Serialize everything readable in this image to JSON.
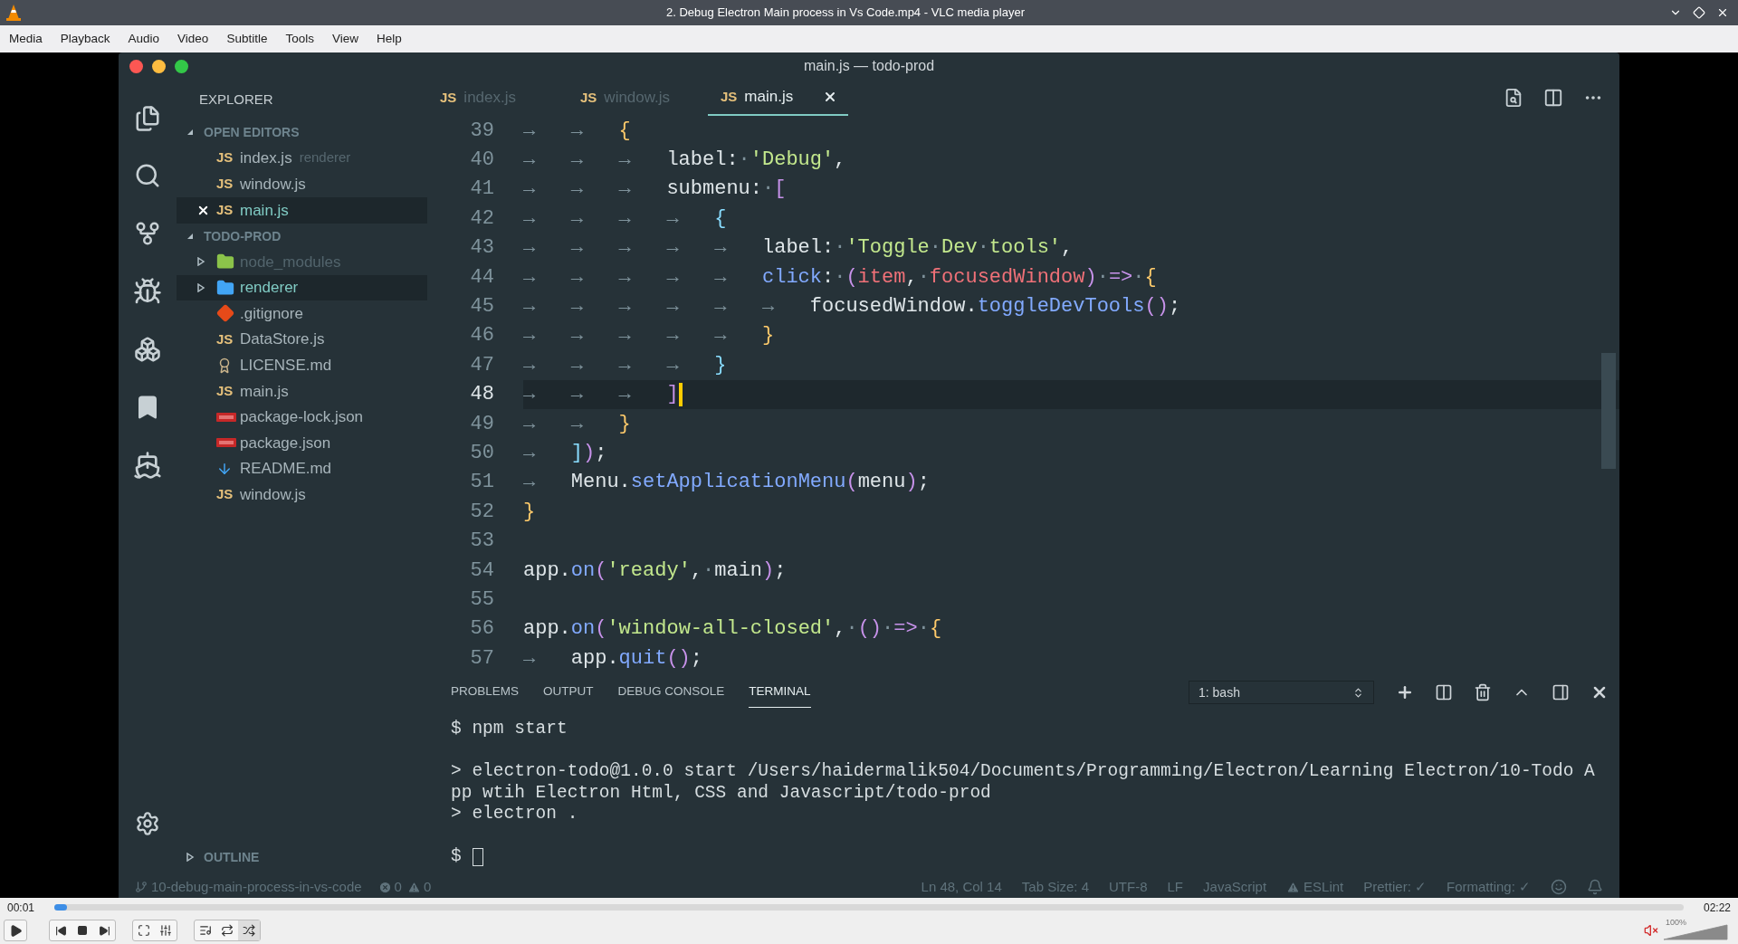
{
  "window": {
    "title": "2. Debug Electron Main process in Vs Code.mp4 - VLC media player"
  },
  "menu": [
    "Media",
    "Playback",
    "Audio",
    "Video",
    "Subtitle",
    "Tools",
    "View",
    "Help"
  ],
  "editor_window": {
    "title": "main.js — todo-prod",
    "explorer": {
      "title": "EXPLORER",
      "open_editors": {
        "title": "OPEN EDITORS",
        "expanded": true,
        "items": [
          {
            "badge": "JS",
            "name": "index.js",
            "detail": "renderer",
            "selected": false
          },
          {
            "badge": "JS",
            "name": "window.js",
            "selected": false
          },
          {
            "badge": "JS",
            "name": "main.js",
            "selected": true
          }
        ]
      },
      "project": {
        "title": "TODO-PROD",
        "expanded": true,
        "items": [
          {
            "kind": "node_folder",
            "name": "node_modules",
            "expanded": false,
            "ignored": true,
            "selected": false
          },
          {
            "kind": "folder",
            "name": "renderer",
            "expanded": false,
            "ignored": false,
            "selected": true
          },
          {
            "kind": "git",
            "name": ".gitignore",
            "ignored": false,
            "selected": false
          },
          {
            "kind": "js",
            "badge": "JS",
            "name": "DataStore.js",
            "ignored": false,
            "selected": false
          },
          {
            "kind": "license",
            "name": "LICENSE.md",
            "ignored": false,
            "selected": false
          },
          {
            "kind": "js",
            "badge": "JS",
            "name": "main.js",
            "ignored": false,
            "selected": false
          },
          {
            "kind": "npm",
            "name": "package-lock.json",
            "ignored": false,
            "selected": false
          },
          {
            "kind": "npm",
            "name": "package.json",
            "ignored": false,
            "selected": false
          },
          {
            "kind": "md",
            "name": "README.md",
            "ignored": false,
            "selected": false
          },
          {
            "kind": "js",
            "badge": "JS",
            "name": "window.js",
            "ignored": false,
            "selected": false
          }
        ]
      },
      "outline": {
        "title": "OUTLINE",
        "expanded": false
      }
    },
    "tabs": [
      {
        "badge": "JS",
        "label": "index.js",
        "selected": false
      },
      {
        "badge": "JS",
        "label": "window.js",
        "selected": false
      },
      {
        "badge": "JS",
        "label": "main.js",
        "selected": true
      }
    ],
    "code": [
      {
        "num": "39",
        "current": false,
        "tokens": [
          {
            "kind": "tab",
            "t": "→"
          },
          {
            "kind": "tab",
            "t": "→"
          },
          {
            "kind": "brace",
            "t": "{"
          }
        ]
      },
      {
        "num": "40",
        "current": false,
        "tokens": [
          {
            "kind": "tab",
            "t": "→"
          },
          {
            "kind": "tab",
            "t": "→"
          },
          {
            "kind": "tab",
            "t": "→"
          },
          {
            "kind": "plain",
            "t": "label:"
          },
          {
            "kind": "ws",
            "t": "·"
          },
          {
            "kind": "str",
            "t": "'Debug'"
          },
          {
            "kind": "plain",
            "t": ","
          }
        ]
      },
      {
        "num": "41",
        "current": false,
        "tokens": [
          {
            "kind": "tab",
            "t": "→"
          },
          {
            "kind": "tab",
            "t": "→"
          },
          {
            "kind": "tab",
            "t": "→"
          },
          {
            "kind": "plain",
            "t": "submenu:"
          },
          {
            "kind": "ws",
            "t": "·"
          },
          {
            "kind": "op",
            "t": "["
          }
        ]
      },
      {
        "num": "42",
        "current": false,
        "tokens": [
          {
            "kind": "tab",
            "t": "→"
          },
          {
            "kind": "tab",
            "t": "→"
          },
          {
            "kind": "tab",
            "t": "→"
          },
          {
            "kind": "tab",
            "t": "→"
          },
          {
            "kind": "punct",
            "t": "{"
          }
        ]
      },
      {
        "num": "43",
        "current": false,
        "tokens": [
          {
            "kind": "tab",
            "t": "→"
          },
          {
            "kind": "tab",
            "t": "→"
          },
          {
            "kind": "tab",
            "t": "→"
          },
          {
            "kind": "tab",
            "t": "→"
          },
          {
            "kind": "tab",
            "t": "→"
          },
          {
            "kind": "plain",
            "t": "label:"
          },
          {
            "kind": "ws",
            "t": "·"
          },
          {
            "kind": "str",
            "t": "'Toggle"
          },
          {
            "kind": "ws",
            "t": "·"
          },
          {
            "kind": "str",
            "t": "Dev"
          },
          {
            "kind": "ws",
            "t": "·"
          },
          {
            "kind": "str",
            "t": "tools'"
          },
          {
            "kind": "plain",
            "t": ","
          }
        ]
      },
      {
        "num": "44",
        "current": false,
        "tokens": [
          {
            "kind": "tab",
            "t": "→"
          },
          {
            "kind": "tab",
            "t": "→"
          },
          {
            "kind": "tab",
            "t": "→"
          },
          {
            "kind": "tab",
            "t": "→"
          },
          {
            "kind": "tab",
            "t": "→"
          },
          {
            "kind": "fn",
            "t": "click"
          },
          {
            "kind": "plain",
            "t": ":"
          },
          {
            "kind": "ws",
            "t": "·"
          },
          {
            "kind": "op",
            "t": "("
          },
          {
            "kind": "param",
            "t": "item"
          },
          {
            "kind": "plain",
            "t": ","
          },
          {
            "kind": "ws",
            "t": "·"
          },
          {
            "kind": "param",
            "t": "focusedWindow"
          },
          {
            "kind": "op",
            "t": ")"
          },
          {
            "kind": "ws",
            "t": "·"
          },
          {
            "kind": "op",
            "t": "=>"
          },
          {
            "kind": "ws",
            "t": "·"
          },
          {
            "kind": "brace",
            "t": "{"
          }
        ]
      },
      {
        "num": "45",
        "current": false,
        "tokens": [
          {
            "kind": "tab",
            "t": "→"
          },
          {
            "kind": "tab",
            "t": "→"
          },
          {
            "kind": "tab",
            "t": "→"
          },
          {
            "kind": "tab",
            "t": "→"
          },
          {
            "kind": "tab",
            "t": "→"
          },
          {
            "kind": "tab",
            "t": "→"
          },
          {
            "kind": "plain",
            "t": "focusedWindow."
          },
          {
            "kind": "fn",
            "t": "toggleDevTools"
          },
          {
            "kind": "op",
            "t": "()"
          },
          {
            "kind": "plain",
            "t": ";"
          }
        ]
      },
      {
        "num": "46",
        "current": false,
        "tokens": [
          {
            "kind": "tab",
            "t": "→"
          },
          {
            "kind": "tab",
            "t": "→"
          },
          {
            "kind": "tab",
            "t": "→"
          },
          {
            "kind": "tab",
            "t": "→"
          },
          {
            "kind": "tab",
            "t": "→"
          },
          {
            "kind": "brace",
            "t": "}"
          }
        ]
      },
      {
        "num": "47",
        "current": false,
        "tokens": [
          {
            "kind": "tab",
            "t": "→"
          },
          {
            "kind": "tab",
            "t": "→"
          },
          {
            "kind": "tab",
            "t": "→"
          },
          {
            "kind": "tab",
            "t": "→"
          },
          {
            "kind": "punct",
            "t": "}"
          }
        ]
      },
      {
        "num": "48",
        "current": true,
        "tokens": [
          {
            "kind": "tab",
            "t": "→"
          },
          {
            "kind": "tab",
            "t": "→"
          },
          {
            "kind": "tab",
            "t": "→"
          },
          {
            "kind": "op",
            "t": "]"
          }
        ]
      },
      {
        "num": "49",
        "current": false,
        "tokens": [
          {
            "kind": "tab",
            "t": "→"
          },
          {
            "kind": "tab",
            "t": "→"
          },
          {
            "kind": "brace",
            "t": "}"
          }
        ]
      },
      {
        "num": "50",
        "current": false,
        "tokens": [
          {
            "kind": "tab",
            "t": "→"
          },
          {
            "kind": "punct",
            "t": "]"
          },
          {
            "kind": "op",
            "t": ")"
          },
          {
            "kind": "plain",
            "t": ";"
          }
        ]
      },
      {
        "num": "51",
        "current": false,
        "tokens": [
          {
            "kind": "tab",
            "t": "→"
          },
          {
            "kind": "plain",
            "t": "Menu."
          },
          {
            "kind": "fn",
            "t": "setApplicationMenu"
          },
          {
            "kind": "op",
            "t": "("
          },
          {
            "kind": "plain",
            "t": "menu"
          },
          {
            "kind": "op",
            "t": ")"
          },
          {
            "kind": "plain",
            "t": ";"
          }
        ]
      },
      {
        "num": "52",
        "current": false,
        "tokens": [
          {
            "kind": "brace",
            "t": "}"
          }
        ]
      },
      {
        "num": "53",
        "current": false
      },
      {
        "num": "54",
        "current": false,
        "tokens": [
          {
            "kind": "plain",
            "t": "app."
          },
          {
            "kind": "fn",
            "t": "on"
          },
          {
            "kind": "op",
            "t": "("
          },
          {
            "kind": "str",
            "t": "'ready'"
          },
          {
            "kind": "plain",
            "t": ","
          },
          {
            "kind": "ws",
            "t": "·"
          },
          {
            "kind": "plain",
            "t": "main"
          },
          {
            "kind": "op",
            "t": ")"
          },
          {
            "kind": "plain",
            "t": ";"
          }
        ]
      },
      {
        "num": "55",
        "current": false
      },
      {
        "num": "56",
        "current": false,
        "tokens": [
          {
            "kind": "plain",
            "t": "app."
          },
          {
            "kind": "fn",
            "t": "on"
          },
          {
            "kind": "op",
            "t": "("
          },
          {
            "kind": "str",
            "t": "'window-all-closed'"
          },
          {
            "kind": "plain",
            "t": ","
          },
          {
            "kind": "ws",
            "t": "·"
          },
          {
            "kind": "op",
            "t": "()"
          },
          {
            "kind": "ws",
            "t": "·"
          },
          {
            "kind": "op",
            "t": "=>"
          },
          {
            "kind": "ws",
            "t": "·"
          },
          {
            "kind": "brace",
            "t": "{"
          }
        ]
      },
      {
        "num": "57",
        "current": false,
        "tokens": [
          {
            "kind": "tab",
            "t": "→"
          },
          {
            "kind": "plain",
            "t": "app."
          },
          {
            "kind": "fn",
            "t": "quit"
          },
          {
            "kind": "op",
            "t": "()"
          },
          {
            "kind": "plain",
            "t": ";"
          }
        ]
      }
    ],
    "panel": {
      "tabs": [
        {
          "label": "PROBLEMS",
          "selected": false
        },
        {
          "label": "OUTPUT",
          "selected": false
        },
        {
          "label": "DEBUG CONSOLE",
          "selected": false
        },
        {
          "label": "TERMINAL",
          "selected": true
        }
      ],
      "terminal_select": "1: bash",
      "terminal": [
        {
          "kind": "text",
          "t": "$ npm start"
        },
        {
          "kind": "blank"
        },
        {
          "kind": "text",
          "t": "> electron-todo@1.0.0 start /Users/haidermalik504/Documents/Programming/Electron/Learning Electron/10-Todo A"
        },
        {
          "kind": "text",
          "t": "pp wtih Electron Html, CSS and Javascript/todo-prod"
        },
        {
          "kind": "text",
          "t": "> electron ."
        },
        {
          "kind": "blank"
        },
        {
          "kind": "prompt",
          "t": "$"
        }
      ]
    },
    "status_bar": {
      "branch": "10-debug-main-process-in-vs-code",
      "errors": "0",
      "warnings": "0",
      "items": [
        {
          "kind": "plain",
          "t": "Ln 48, Col 14"
        },
        {
          "kind": "plain",
          "t": "Tab Size: 4"
        },
        {
          "kind": "plain",
          "t": "UTF-8"
        },
        {
          "kind": "plain",
          "t": "LF"
        },
        {
          "kind": "plain",
          "t": "JavaScript"
        },
        {
          "kind": "warning",
          "t": "ESLint"
        },
        {
          "kind": "plain",
          "t": "Prettier: ✓"
        },
        {
          "kind": "plain",
          "t": "Formatting: ✓"
        }
      ]
    }
  },
  "player": {
    "elapsed": "00:01",
    "total": "02:22",
    "level": 0.008,
    "volume": {
      "label": "100%",
      "level": 1,
      "muted": true
    }
  }
}
